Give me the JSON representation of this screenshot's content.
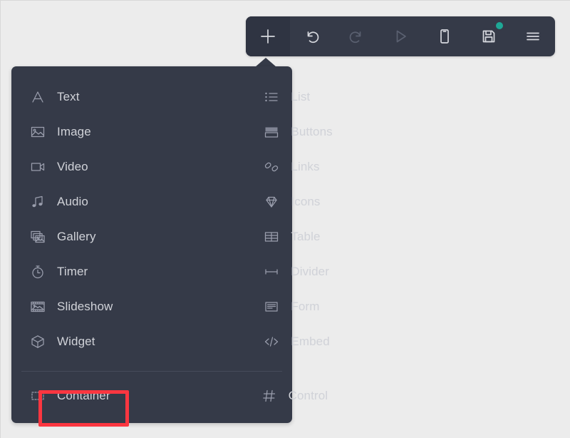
{
  "app": {
    "background_color": "#ececec",
    "panel_color": "#353a48",
    "accent_color": "#fb3640",
    "save_dot_color": "#1ea896",
    "label_color": "#d0d2d8",
    "icon_color": "#9a9ead"
  },
  "toolbar": {
    "buttons": [
      {
        "name": "add-element-button",
        "icon": "plus-icon",
        "label": "Add",
        "active": true,
        "enabled": true
      },
      {
        "name": "undo-button",
        "icon": "undo-icon",
        "label": "Undo",
        "active": false,
        "enabled": true
      },
      {
        "name": "redo-button",
        "icon": "redo-icon",
        "label": "Redo",
        "active": false,
        "enabled": false
      },
      {
        "name": "preview-button",
        "icon": "play-icon",
        "label": "Preview",
        "active": false,
        "enabled": false
      },
      {
        "name": "device-button",
        "icon": "mobile-icon",
        "label": "Mobile view",
        "active": false,
        "enabled": true
      },
      {
        "name": "save-button",
        "icon": "save-icon",
        "label": "Save",
        "active": false,
        "enabled": true,
        "badge": true
      },
      {
        "name": "menu-button",
        "icon": "hamburger-icon",
        "label": "Menu",
        "active": false,
        "enabled": true
      }
    ]
  },
  "menu": {
    "items_main": [
      {
        "label": "Text",
        "icon": "text-icon",
        "column": "left"
      },
      {
        "label": "List",
        "icon": "list-icon",
        "column": "right"
      },
      {
        "label": "Image",
        "icon": "image-icon",
        "column": "left"
      },
      {
        "label": "Buttons",
        "icon": "buttons-icon",
        "column": "right"
      },
      {
        "label": "Video",
        "icon": "video-icon",
        "column": "left"
      },
      {
        "label": "Links",
        "icon": "links-icon",
        "column": "right"
      },
      {
        "label": "Audio",
        "icon": "audio-icon",
        "column": "left"
      },
      {
        "label": "Icons",
        "icon": "diamond-icon",
        "column": "right"
      },
      {
        "label": "Gallery",
        "icon": "gallery-icon",
        "column": "left"
      },
      {
        "label": "Table",
        "icon": "table-icon",
        "column": "right"
      },
      {
        "label": "Timer",
        "icon": "timer-icon",
        "column": "left"
      },
      {
        "label": "Divider",
        "icon": "divider-icon",
        "column": "right"
      },
      {
        "label": "Slideshow",
        "icon": "slideshow-icon",
        "column": "left"
      },
      {
        "label": "Form",
        "icon": "form-icon",
        "column": "right"
      },
      {
        "label": "Widget",
        "icon": "cube-icon",
        "column": "left",
        "highlighted": true
      },
      {
        "label": "Embed",
        "icon": "code-icon",
        "column": "right"
      }
    ],
    "items_bottom": [
      {
        "label": "Container",
        "icon": "container-icon",
        "column": "left"
      },
      {
        "label": "Control",
        "icon": "hash-icon",
        "column": "right"
      }
    ],
    "highlighted_item": "Widget"
  }
}
